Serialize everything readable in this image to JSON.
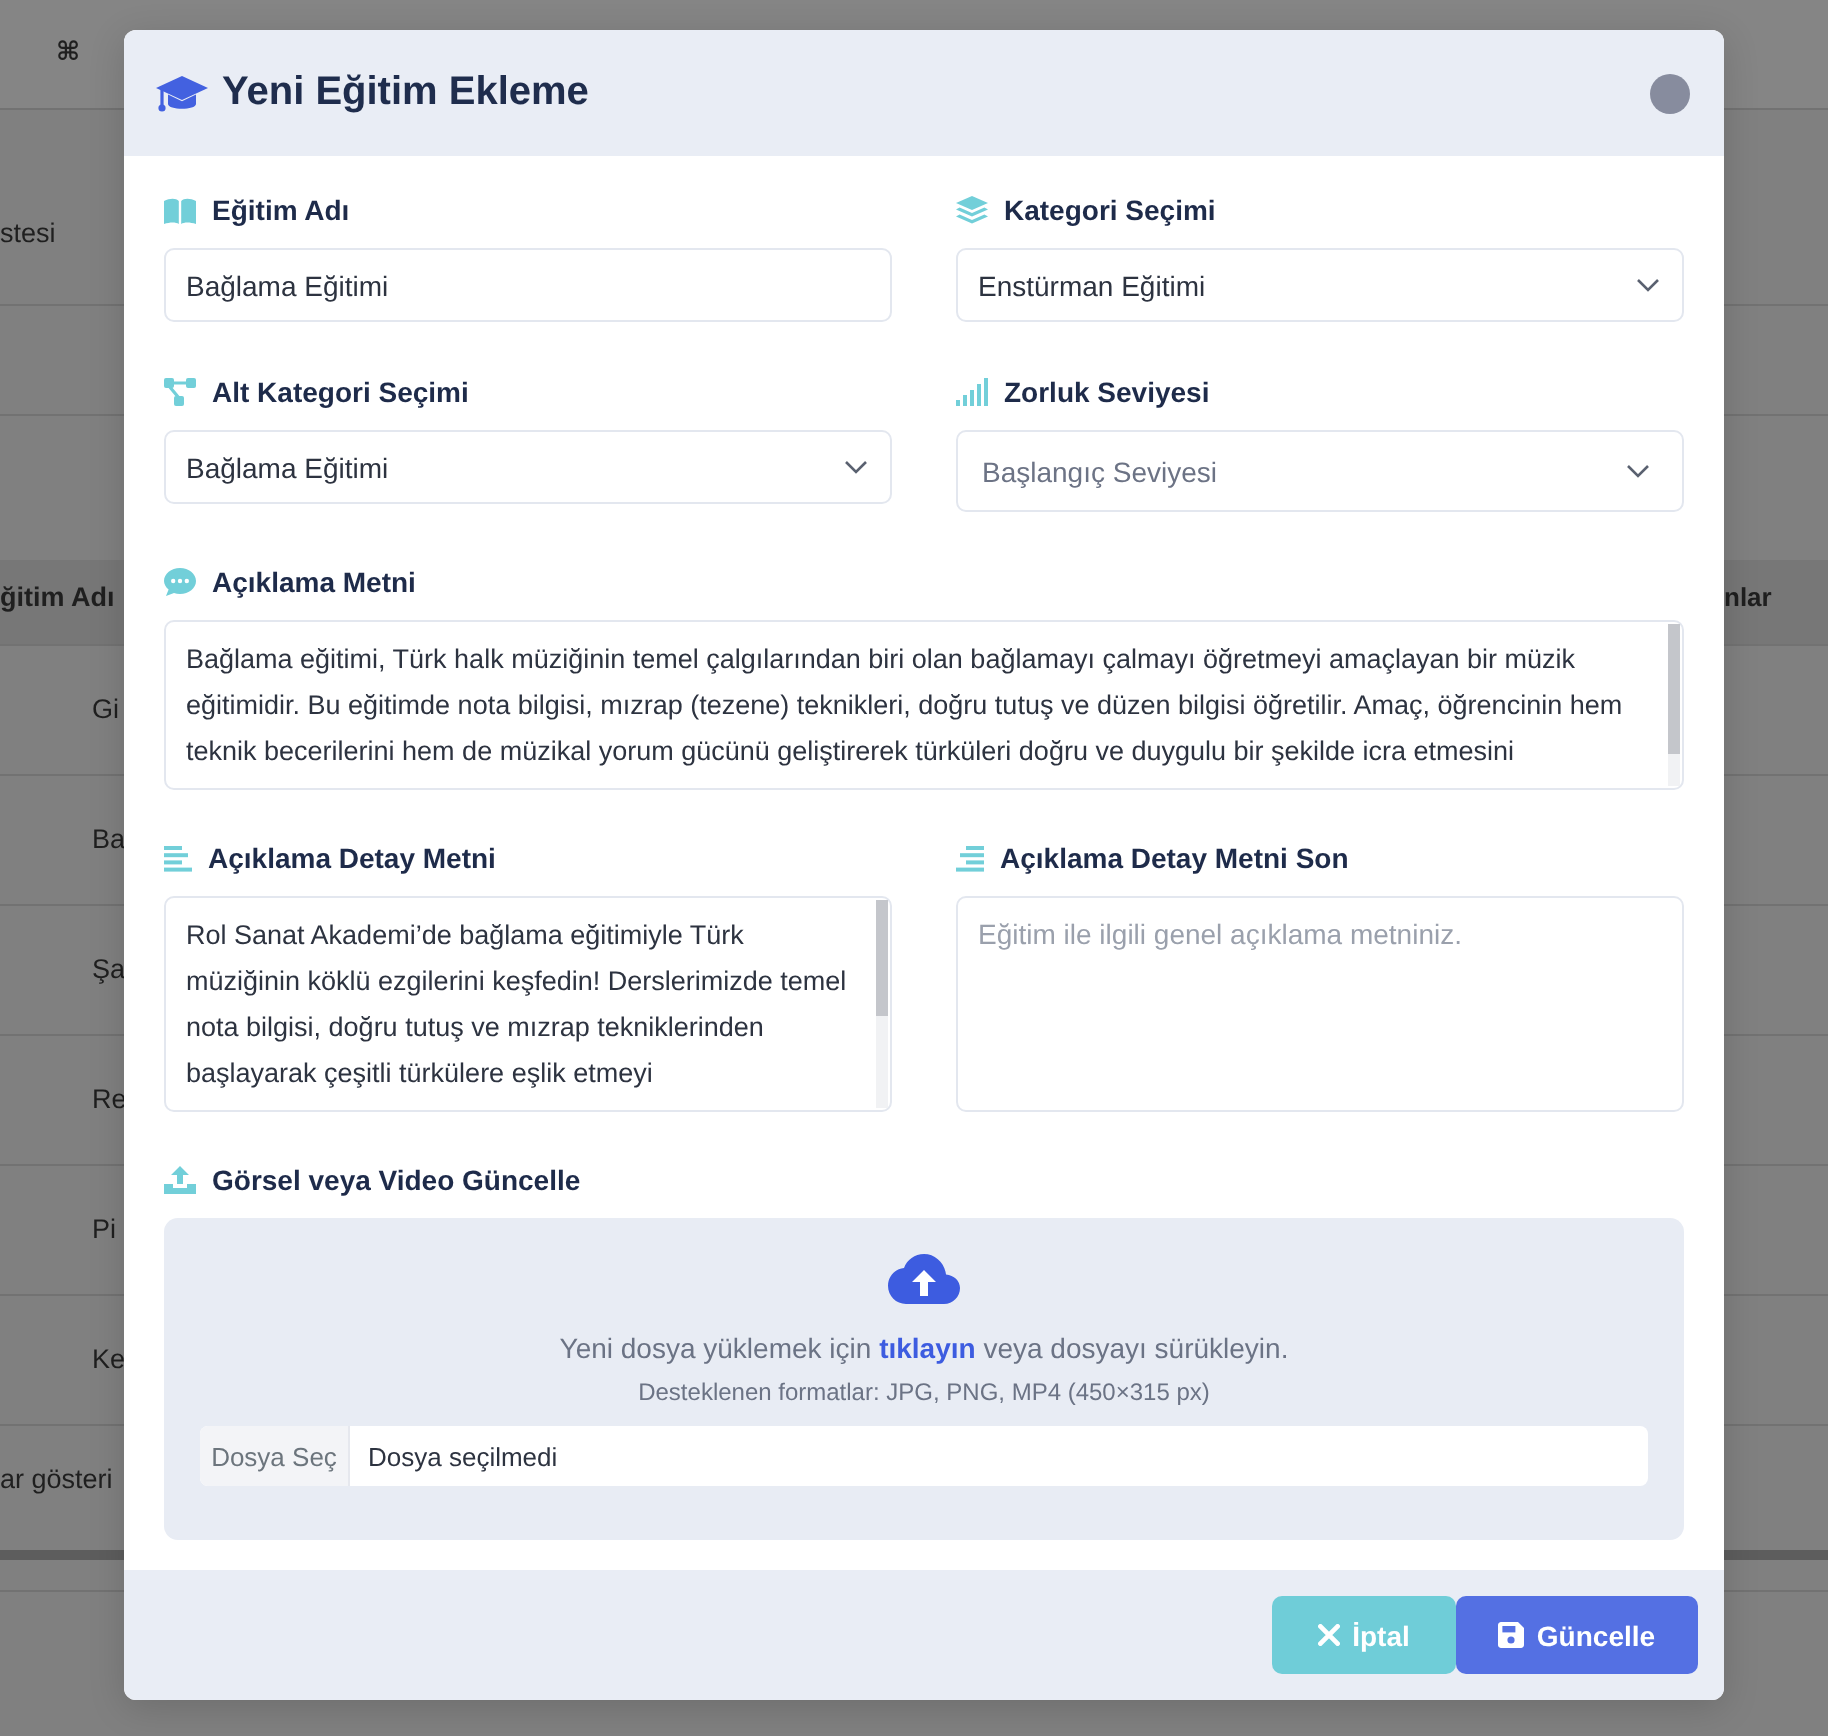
{
  "background_page": {
    "shortcut_key": "⌘",
    "heading": "stesi",
    "table": {
      "columns": [
        "ğitim Adı",
        "nlar"
      ],
      "rows": [
        "Gi",
        "Ba",
        "Şa",
        "Re",
        "Pi",
        "Ke"
      ]
    },
    "footer": "ar gösteri"
  },
  "dialog": {
    "title": "Yeni Eğitim Ekleme",
    "rows": [
      [
        {
          "kind": "text",
          "label": "Eğitim Adı",
          "value": "Bağlama Eğitimi"
        },
        {
          "kind": "select",
          "label": "Kategori Seçimi",
          "value": "Enstürman Eğitimi"
        }
      ],
      [
        {
          "kind": "select",
          "label": "Alt Kategori Seçimi",
          "value": "Bağlama Eğitimi"
        },
        {
          "kind": "select",
          "label": "Zorluk Seviyesi",
          "placeholder": "Başlangıç Seviyesi"
        }
      ],
      [
        {
          "kind": "textarea",
          "label": "Açıklama Metni",
          "value": "Bağlama eğitimi, Türk halk müziğinin temel çalgılarından biri olan bağlamayı çalmayı öğretmeyi amaçlayan bir müzik eğitimidir. Bu eğitimde nota bilgisi, mızrap (tezene) teknikleri, doğru tutuş ve düzen bilgisi öğretilir. Amaç, öğrencinin hem teknik becerilerini hem de müzikal yorum gücünü geliştirerek türküleri doğru ve duygulu bir şekilde icra etmesini"
        }
      ],
      [
        {
          "kind": "textarea",
          "label": "Açıklama Detay Metni",
          "value": "Rol Sanat Akademi’de bağlama eğitimiyle Türk müziğinin köklü ezgilerini keşfedin! Derslerimizde temel nota bilgisi, doğru tutuş ve mızrap tekniklerinden başlayarak çeşitli türkülere eşlik etmeyi"
        },
        {
          "kind": "textarea",
          "label": "Açıklama Detay Metni Son",
          "placeholder": "Eğitim ile ilgili genel açıklama metniniz."
        }
      ]
    ],
    "upload": {
      "label": "Görsel veya Video Güncelle",
      "instruction": "Yeni dosya yüklemek için **tıklayın** veya dosyayı sürükleyin.",
      "formats": "Desteklenen formatlar: JPG, PNG, MP4 (450×315 px)",
      "file_button": "Dosya Seç",
      "file_status": "Dosya seçilmedi"
    },
    "buttons": [
      {
        "kind": "cancel",
        "label": "İptal"
      },
      {
        "kind": "submit",
        "label": "Güncelle"
      }
    ]
  }
}
